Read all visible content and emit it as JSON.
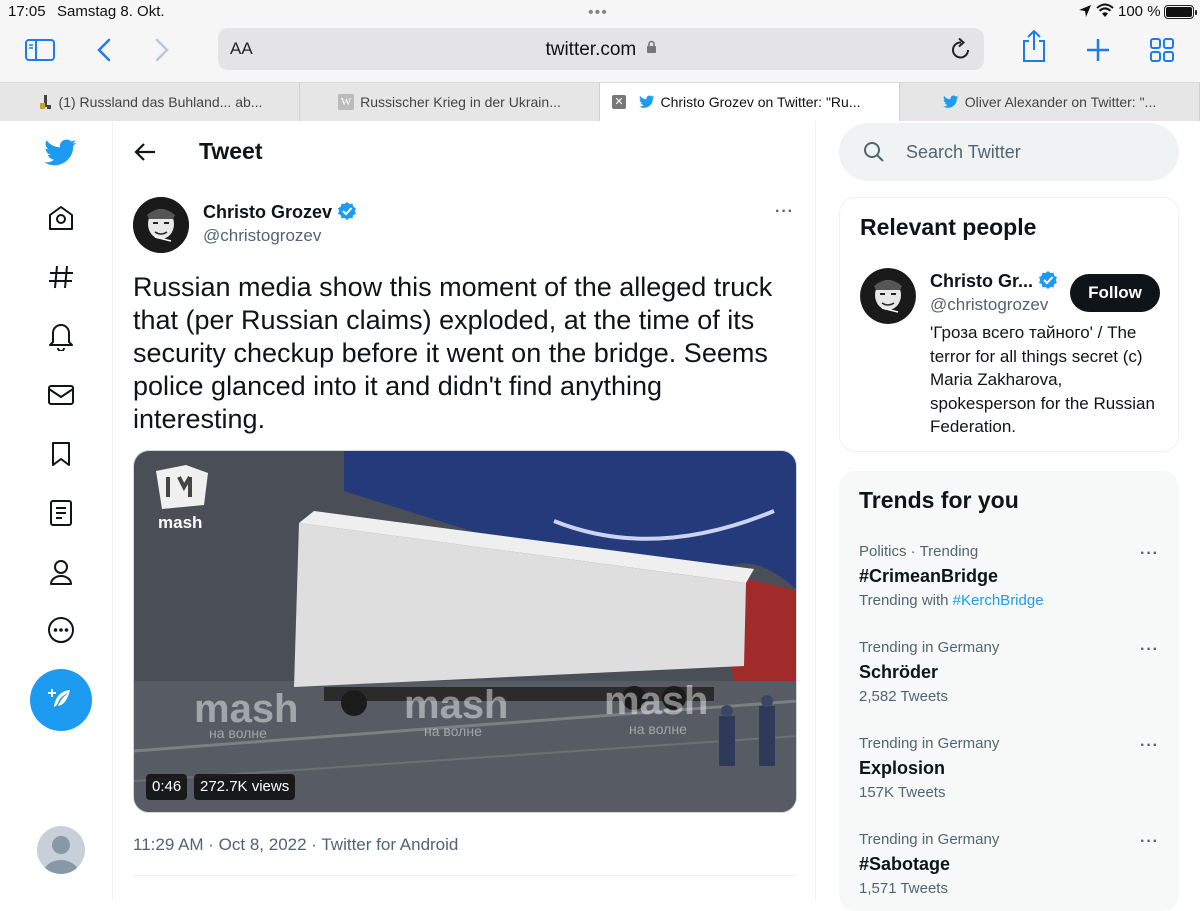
{
  "status_bar": {
    "time": "17:05",
    "date": "Samstag 8. Okt.",
    "battery": "100 %"
  },
  "browser": {
    "text_size_label": "AA",
    "url": "twitter.com",
    "tabs": [
      {
        "title": "(1) Russland das Buhland... ab..."
      },
      {
        "title": "Russischer Krieg in der Ukrain..."
      },
      {
        "title": "Christo Grozev on Twitter: \"Ru..."
      },
      {
        "title": "Oliver Alexander on Twitter: \"..."
      }
    ]
  },
  "header": {
    "title": "Tweet"
  },
  "tweet": {
    "author_name": "Christo Grozev",
    "author_handle": "@christogrozev",
    "text": "Russian media show this moment of the alleged truck that (per Russian claims) exploded, at the time of its security checkup before it went on the bridge. Seems police glanced into it and didn't find anything interesting.",
    "video_duration": "0:46",
    "video_views": "272.7K views",
    "timestamp": "11:29 AM · Oct 8, 2022 · Twitter for Android",
    "media_watermark": {
      "logo": "mash",
      "tagline": "на волне"
    }
  },
  "search": {
    "placeholder": "Search Twitter"
  },
  "relevant_people": {
    "heading": "Relevant people",
    "person": {
      "name": "Christo Gr...",
      "handle": "@christogrozev",
      "follow_label": "Follow",
      "bio": "'Гроза всего тайного' / The terror for all things secret (c) Maria Zakharova, spokesperson for the Russian Federation."
    }
  },
  "trends": {
    "heading": "Trends for you",
    "items": [
      {
        "meta": "Politics · Trending",
        "name": "#CrimeanBridge",
        "sub_prefix": "Trending with ",
        "sub_link": "#KerchBridge"
      },
      {
        "meta": "Trending in Germany",
        "name": "Schröder",
        "sub": "2,582 Tweets"
      },
      {
        "meta": "Trending in Germany",
        "name": "Explosion",
        "sub": "157K Tweets"
      },
      {
        "meta": "Trending in Germany",
        "name": "#Sabotage",
        "sub": "1,571 Tweets"
      }
    ]
  },
  "colors": {
    "accent": "#1d9bf0",
    "safari_blue": "#1d7bf0",
    "text": "#0f1419",
    "muted": "#536471"
  }
}
